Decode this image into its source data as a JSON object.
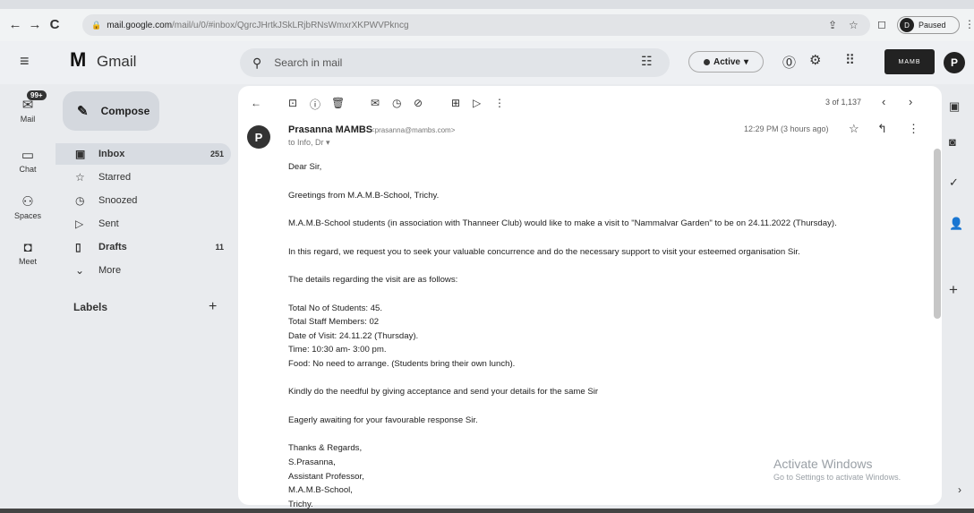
{
  "browser": {
    "url_host": "mail.google.com",
    "url_path": "/mail/u/0/#inbox/QgrcJHrtkJSkLRjbRNsWmxrXKPWVPkncg",
    "profile_initial": "D",
    "profile_status": "Paused"
  },
  "header": {
    "app_name": "Gmail",
    "search_placeholder": "Search in mail",
    "status": "Active",
    "avatar_initial": "P",
    "org_logo_text": "MAMB"
  },
  "rail": {
    "badge": "99+",
    "items": [
      {
        "label": "Mail",
        "icon": "mail-icon"
      },
      {
        "label": "Chat",
        "icon": "chat-icon"
      },
      {
        "label": "Spaces",
        "icon": "spaces-icon"
      },
      {
        "label": "Meet",
        "icon": "meet-icon"
      }
    ]
  },
  "sidebar": {
    "compose": "Compose",
    "items": [
      {
        "label": "Inbox",
        "count": "251",
        "icon": "inbox-icon"
      },
      {
        "label": "Starred",
        "count": "",
        "icon": "star-icon"
      },
      {
        "label": "Snoozed",
        "count": "",
        "icon": "clock-icon"
      },
      {
        "label": "Sent",
        "count": "",
        "icon": "send-icon"
      },
      {
        "label": "Drafts",
        "count": "11",
        "icon": "draft-icon"
      },
      {
        "label": "More",
        "count": "",
        "icon": "chevron-down-icon"
      }
    ],
    "labels_title": "Labels"
  },
  "message": {
    "pager": "3 of 1,137",
    "sender_name": "Prasanna MAMBS",
    "sender_email": "<prasanna@mambs.com>",
    "to_line": "to Info, Dr ▾",
    "time": "12:29 PM (3 hours ago)",
    "avatar_initial": "P",
    "body": {
      "greeting": "Dear Sir,",
      "p1": "Greetings from M.A.M.B-School, Trichy.",
      "p2": "M.A.M.B-School students (in association with Thanneer Club) would like to make a visit to \"Nammalvar Garden\" to be on 24.11.2022 (Thursday).",
      "p3": "In this regard, we request you to seek your valuable concurrence and do the necessary support to visit your esteemed organisation Sir.",
      "p4": "The details regarding the visit are as follows:",
      "d1": "Total No of Students: 45.",
      "d2": "Total Staff Members: 02",
      "d3": "Date of Visit: 24.11.22 (Thursday).",
      "d4": "Time: 10:30 am- 3:00 pm.",
      "d5": "Food: No need to arrange. (Students bring their own lunch).",
      "p5": "Kindly do the needful by giving acceptance and send your details for the same Sir",
      "p6": "Eagerly awaiting for your favourable response Sir.",
      "s1": "Thanks & Regards,",
      "s2": "S.Prasanna,",
      "s3": "Assistant Professor,",
      "s4": "M.A.M.B-School,",
      "s5": "Trichy."
    }
  },
  "watermark": {
    "title": "Activate Windows",
    "subtitle": "Go to Settings to activate Windows."
  }
}
